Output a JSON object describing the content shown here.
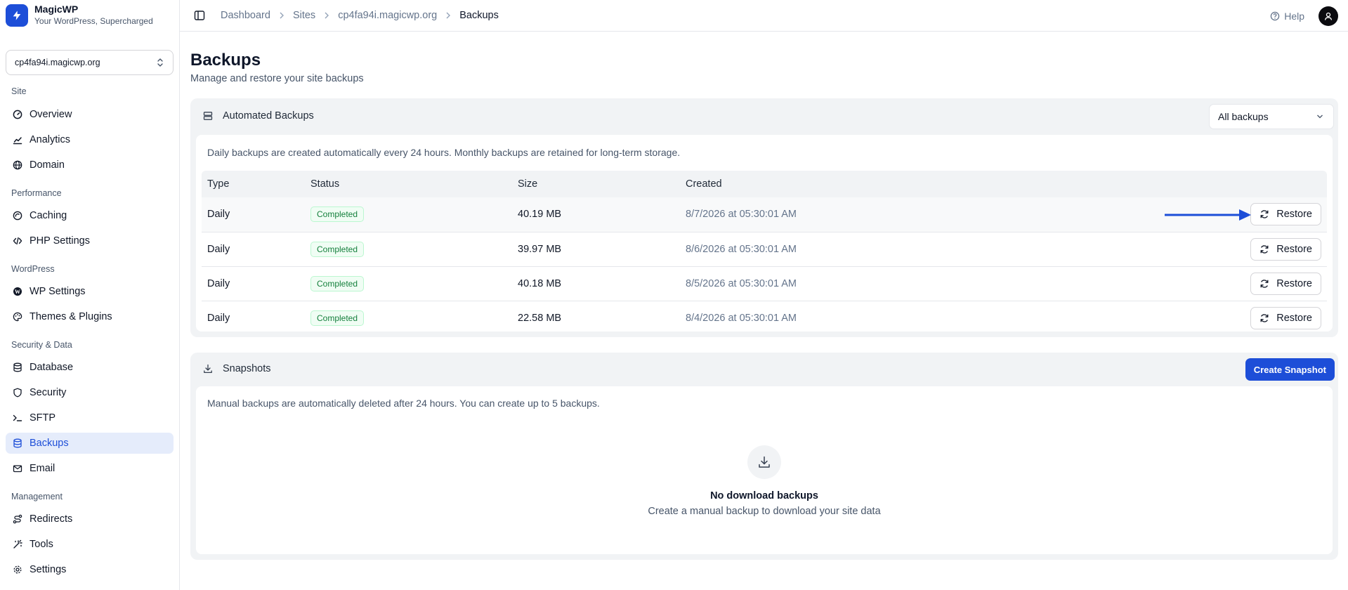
{
  "brand": {
    "name": "MagicWP",
    "tagline": "Your WordPress, Supercharged"
  },
  "site_selector": {
    "value": "cp4fa94i.magicwp.org"
  },
  "sidebar": {
    "groups": [
      {
        "label": "Site",
        "items": [
          {
            "label": "Overview",
            "icon": "gauge-icon"
          },
          {
            "label": "Analytics",
            "icon": "chart-line-icon"
          },
          {
            "label": "Domain",
            "icon": "globe-icon"
          }
        ]
      },
      {
        "label": "Performance",
        "items": [
          {
            "label": "Caching",
            "icon": "cache-icon"
          },
          {
            "label": "PHP Settings",
            "icon": "code-icon"
          }
        ]
      },
      {
        "label": "WordPress",
        "items": [
          {
            "label": "WP Settings",
            "icon": "wordpress-icon"
          },
          {
            "label": "Themes & Plugins",
            "icon": "palette-icon"
          }
        ]
      },
      {
        "label": "Security & Data",
        "items": [
          {
            "label": "Database",
            "icon": "database-icon"
          },
          {
            "label": "Security",
            "icon": "shield-icon"
          },
          {
            "label": "SFTP",
            "icon": "terminal-icon"
          },
          {
            "label": "Backups",
            "icon": "server-icon",
            "active": true
          },
          {
            "label": "Email",
            "icon": "mail-icon"
          }
        ]
      },
      {
        "label": "Management",
        "items": [
          {
            "label": "Redirects",
            "icon": "route-icon"
          },
          {
            "label": "Tools",
            "icon": "wand-icon"
          },
          {
            "label": "Settings",
            "icon": "gear-icon"
          }
        ]
      }
    ]
  },
  "header": {
    "breadcrumbs": [
      "Dashboard",
      "Sites",
      "cp4fa94i.magicwp.org",
      "Backups"
    ],
    "help_label": "Help"
  },
  "page": {
    "title": "Backups",
    "subtitle": "Manage and restore your site backups"
  },
  "automated": {
    "title": "Automated Backups",
    "filter_value": "All backups",
    "description": "Daily backups are created automatically every 24 hours. Monthly backups are retained for long-term storage.",
    "columns": [
      "Type",
      "Status",
      "Size",
      "Created"
    ],
    "rows": [
      {
        "type": "Daily",
        "status": "Completed",
        "size": "40.19 MB",
        "created": "8/7/2026 at 05:30:01 AM",
        "action": "Restore"
      },
      {
        "type": "Daily",
        "status": "Completed",
        "size": "39.97 MB",
        "created": "8/6/2026 at 05:30:01 AM",
        "action": "Restore"
      },
      {
        "type": "Daily",
        "status": "Completed",
        "size": "40.18 MB",
        "created": "8/5/2026 at 05:30:01 AM",
        "action": "Restore"
      },
      {
        "type": "Daily",
        "status": "Completed",
        "size": "22.58 MB",
        "created": "8/4/2026 at 05:30:01 AM",
        "action": "Restore"
      }
    ]
  },
  "snapshots": {
    "title": "Snapshots",
    "create_label": "Create Snapshot",
    "description": "Manual backups are automatically deleted after 24 hours. You can create up to 5 backups.",
    "empty_title": "No download backups",
    "empty_subtitle": "Create a manual backup to download your site data"
  },
  "colors": {
    "accent": "#1d4ed8",
    "success": "#15803d",
    "arrow": "#1d4ed8"
  }
}
